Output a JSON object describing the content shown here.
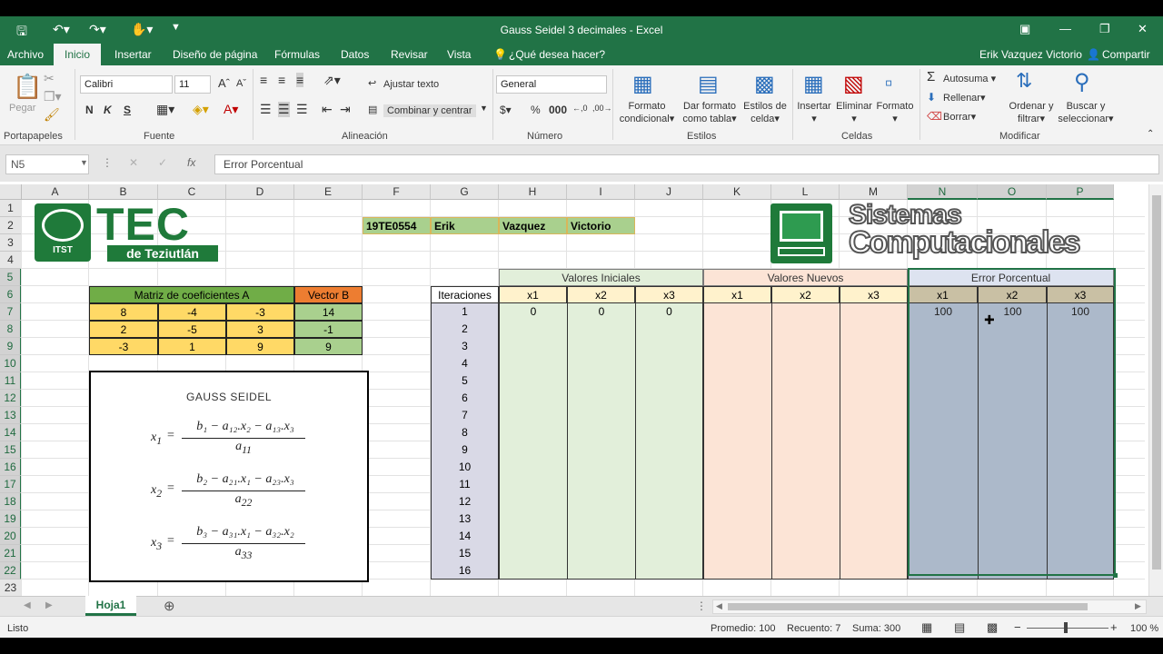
{
  "window": {
    "title": "Gauss Seidel 3 decimales - Excel"
  },
  "menu": {
    "tabs": [
      "Archivo",
      "Inicio",
      "Insertar",
      "Diseño de página",
      "Fórmulas",
      "Datos",
      "Revisar",
      "Vista"
    ],
    "tell_me": "¿Qué desea hacer?",
    "user": "Erik Vazquez Victorio",
    "share": "Compartir"
  },
  "ribbon": {
    "paste": "Pegar",
    "font_name": "Calibri",
    "font_size": "11",
    "bold": "N",
    "italic": "K",
    "underline": "S",
    "wrap_text": "Ajustar texto",
    "merge_center": "Combinar y centrar",
    "number_format": "General",
    "cond_format": [
      "Formato",
      "condicional"
    ],
    "format_table": [
      "Dar formato",
      "como tabla"
    ],
    "cell_styles": [
      "Estilos de",
      "celda"
    ],
    "insert": "Insertar",
    "delete": "Eliminar",
    "format": "Formato",
    "autosum": "Autosuma",
    "fill": "Rellenar",
    "clear": "Borrar",
    "sort_filter": [
      "Ordenar y",
      "filtrar"
    ],
    "find_select": [
      "Buscar y",
      "seleccionar"
    ],
    "groups": [
      "Portapapeles",
      "Fuente",
      "Alineación",
      "Número",
      "Estilos",
      "Celdas",
      "Modificar"
    ]
  },
  "formula_bar": {
    "name_box": "N5",
    "fx": "fx",
    "formula": "Error Porcentual"
  },
  "columns": [
    "A",
    "B",
    "C",
    "D",
    "E",
    "F",
    "G",
    "H",
    "I",
    "J",
    "K",
    "L",
    "M",
    "N",
    "O",
    "P"
  ],
  "rows": [
    "1",
    "2",
    "3",
    "4",
    "5",
    "6",
    "7",
    "8",
    "9",
    "10",
    "11",
    "12",
    "13",
    "14",
    "15",
    "16",
    "17",
    "18",
    "19",
    "20",
    "21",
    "22",
    "23"
  ],
  "logos": {
    "tec_big": "TEC",
    "tec_small": "de Teziutlán",
    "seal": "ITST",
    "sis1": "Sistemas",
    "sis2": "Computacionales"
  },
  "student": [
    "19TE0554",
    "Erik",
    "Vazquez",
    "Victorio"
  ],
  "matrix": {
    "header_a": "Matriz de coeficientes A",
    "header_b": "Vector B",
    "rows": [
      [
        "8",
        "-4",
        "-3",
        "14"
      ],
      [
        "2",
        "-5",
        "3",
        "-1"
      ],
      [
        "-3",
        "1",
        "9",
        "9"
      ]
    ]
  },
  "formula_box": {
    "title": "GAUSS SEIDEL",
    "eqs": [
      {
        "lhs": "x",
        "lsub": "1",
        "num": "b₁ − a₁₂.x₂ − a₁₃.x₃",
        "den": "a",
        "dsub": "11"
      },
      {
        "lhs": "x",
        "lsub": "2",
        "num": "b₂ − a₂₁.x₁ − a₂₃.x₃",
        "den": "a",
        "dsub": "22"
      },
      {
        "lhs": "x",
        "lsub": "3",
        "num": "b₃ − a₃₁.x₁ − a₃₂.x₂",
        "den": "a",
        "dsub": "33"
      }
    ]
  },
  "table": {
    "iter_header": "Iteraciones",
    "groups": [
      "Valores Iniciales",
      "Valores Nuevos",
      "Error Porcentual"
    ],
    "sub": [
      "x1",
      "x2",
      "x3"
    ],
    "iterations": [
      "1",
      "2",
      "3",
      "4",
      "5",
      "6",
      "7",
      "8",
      "9",
      "10",
      "11",
      "12",
      "13",
      "14",
      "15",
      "16"
    ],
    "row1_initial": [
      "0",
      "0",
      "0"
    ],
    "row1_error": [
      "100",
      "100",
      "100"
    ]
  },
  "colors": {
    "excel_green": "#217346",
    "group1": "#e2efda",
    "group2": "#fce4d6",
    "group3": "#acb9ca",
    "matrix_header": "#70ad47",
    "vector_header": "#ed7d31",
    "matrix_body": "#ffd966",
    "vector_body": "#a9d08e",
    "iter_fill": "#d9d9e6"
  },
  "sheet": {
    "tab": "Hoja1"
  },
  "status": {
    "ready": "Listo",
    "avg": "Promedio: 100",
    "count": "Recuento: 7",
    "sum": "Suma: 300",
    "zoom": "100 %"
  }
}
